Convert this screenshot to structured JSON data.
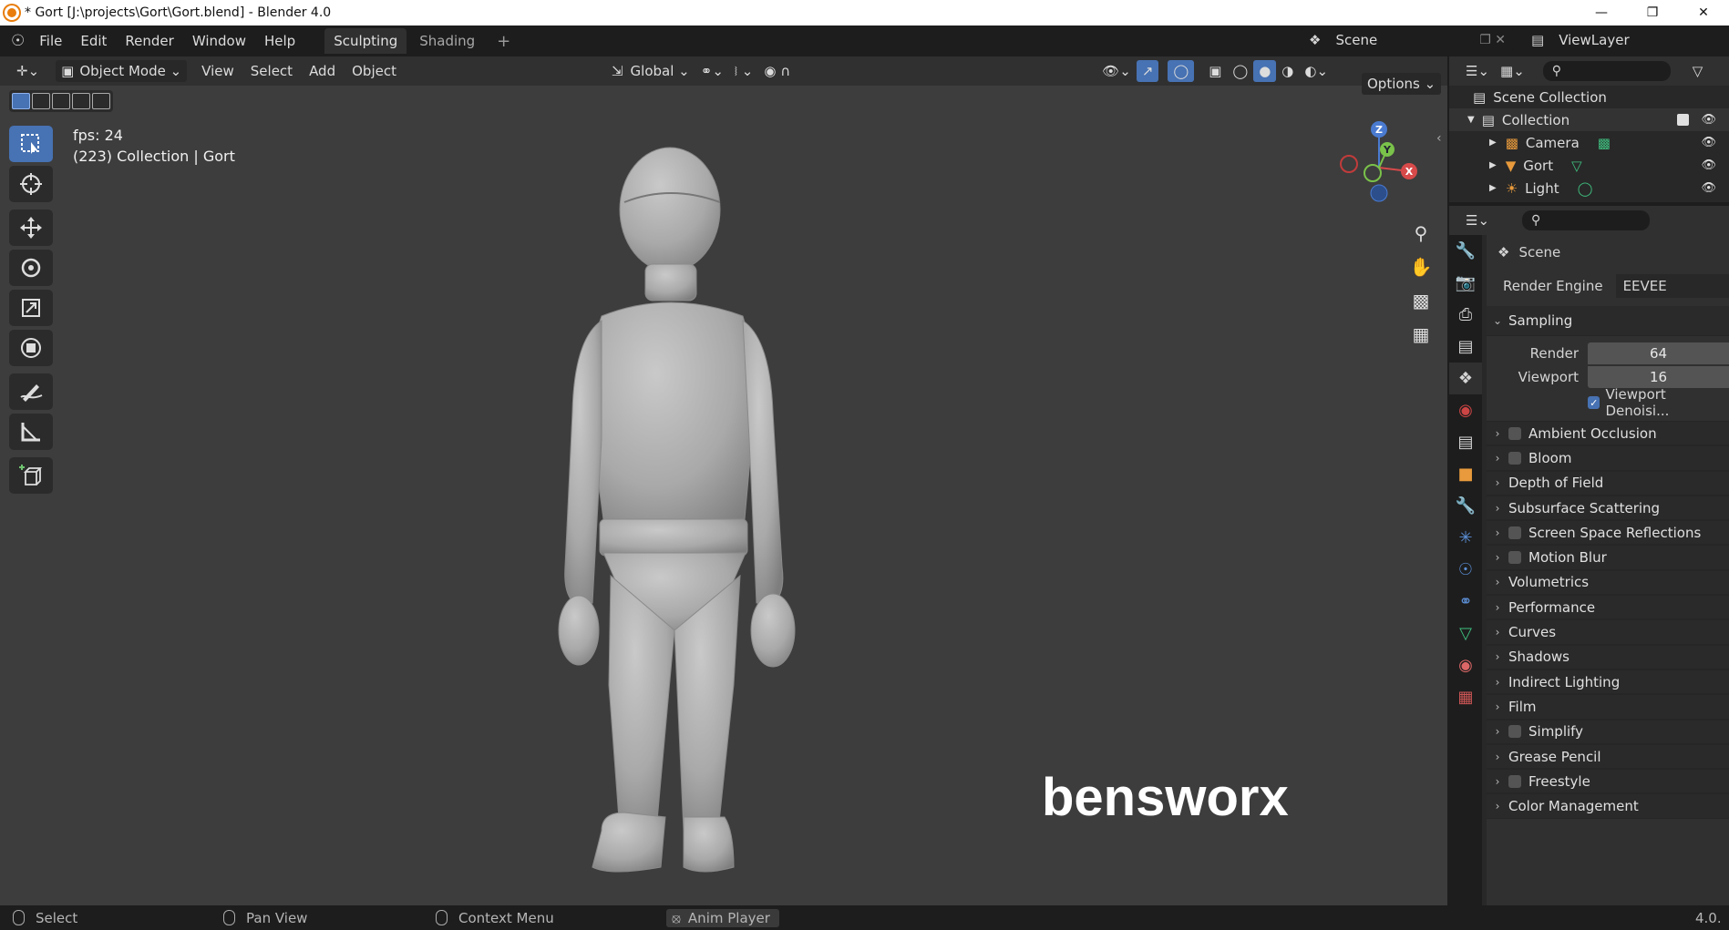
{
  "titlebar": {
    "text": "* Gort [J:\\projects\\Gort\\Gort.blend] - Blender 4.0"
  },
  "menubar": {
    "items": [
      "File",
      "Edit",
      "Render",
      "Window",
      "Help"
    ],
    "workspace_tabs": [
      "Sculpting",
      "Shading"
    ],
    "active_tab": "Sculpting",
    "scene": "Scene",
    "view_layer": "ViewLayer"
  },
  "viewport": {
    "mode": "Object Mode",
    "menus": [
      "View",
      "Select",
      "Add",
      "Object"
    ],
    "orientation": "Global",
    "options_label": "Options",
    "overlay_fps": "fps: 24",
    "overlay_info": "(223) Collection | Gort",
    "gizmo_labels": {
      "z": "Z",
      "y": "Y",
      "x": "X"
    },
    "watermark": "bensworx"
  },
  "outliner": {
    "root": "Scene Collection",
    "collection": "Collection",
    "items": [
      {
        "label": "Camera",
        "icon": "camera-icon"
      },
      {
        "label": "Gort",
        "icon": "mesh-icon"
      },
      {
        "label": "Light",
        "icon": "light-icon"
      }
    ]
  },
  "properties": {
    "context": "Scene",
    "render_engine_label": "Render Engine",
    "render_engine": "EEVEE",
    "sampling": {
      "title": "Sampling",
      "render_label": "Render",
      "render_value": "64",
      "viewport_label": "Viewport",
      "viewport_value": "16",
      "denoise_label": "Viewport Denoisi..."
    },
    "panels": [
      {
        "label": "Ambient Occlusion",
        "checkbox": true
      },
      {
        "label": "Bloom",
        "checkbox": true
      },
      {
        "label": "Depth of Field",
        "checkbox": false
      },
      {
        "label": "Subsurface Scattering",
        "checkbox": false
      },
      {
        "label": "Screen Space Reflections",
        "checkbox": true
      },
      {
        "label": "Motion Blur",
        "checkbox": true
      },
      {
        "label": "Volumetrics",
        "checkbox": false
      },
      {
        "label": "Performance",
        "checkbox": false
      },
      {
        "label": "Curves",
        "checkbox": false
      },
      {
        "label": "Shadows",
        "checkbox": false
      },
      {
        "label": "Indirect Lighting",
        "checkbox": false
      },
      {
        "label": "Film",
        "checkbox": false
      },
      {
        "label": "Simplify",
        "checkbox": true
      },
      {
        "label": "Grease Pencil",
        "checkbox": false
      },
      {
        "label": "Freestyle",
        "checkbox": true
      },
      {
        "label": "Color Management",
        "checkbox": false
      }
    ]
  },
  "statusbar": {
    "select": "Select",
    "pan": "Pan View",
    "context": "Context Menu",
    "anim": "Anim Player",
    "version": "4.0."
  },
  "colors": {
    "accent": "#4772b3",
    "active_tool": "#4772b3",
    "viewport_bg": "#3d3d3d"
  }
}
